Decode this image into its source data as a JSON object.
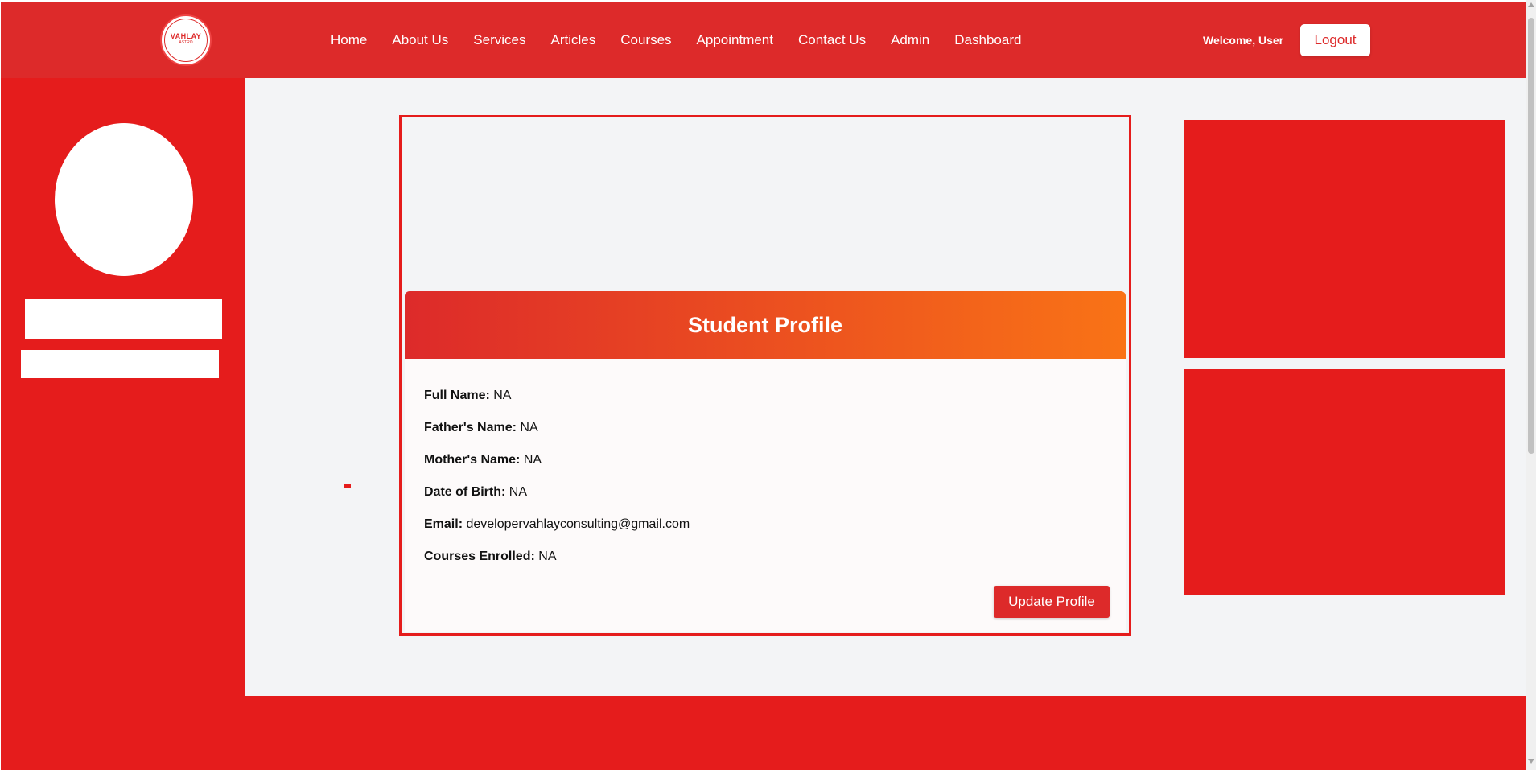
{
  "header": {
    "logo": {
      "text": "VAHLAY",
      "subtext": "ASTRO",
      "icon": "brand-logo"
    },
    "nav_items": [
      {
        "label": "Home"
      },
      {
        "label": "About Us"
      },
      {
        "label": "Services"
      },
      {
        "label": "Articles"
      },
      {
        "label": "Courses"
      },
      {
        "label": "Appointment"
      },
      {
        "label": "Contact Us"
      },
      {
        "label": "Admin"
      },
      {
        "label": "Dashboard"
      }
    ],
    "welcome_text": "Welcome, User",
    "logout_label": "Logout"
  },
  "profile": {
    "title": "Student Profile",
    "fields": [
      {
        "label": "Full Name:",
        "value": "NA"
      },
      {
        "label": "Father's Name:",
        "value": "NA"
      },
      {
        "label": "Mother's Name:",
        "value": "NA"
      },
      {
        "label": "Date of Birth:",
        "value": "NA"
      },
      {
        "label": "Email:",
        "value": "developervahlayconsulting@gmail.com"
      },
      {
        "label": "Courses Enrolled:",
        "value": "NA"
      }
    ],
    "update_label": "Update Profile"
  },
  "colors": {
    "brand_red": "#dd2a2a",
    "accent_red": "#e51c1c",
    "gradient_end": "#f97316",
    "page_bg": "#f3f4f6"
  }
}
